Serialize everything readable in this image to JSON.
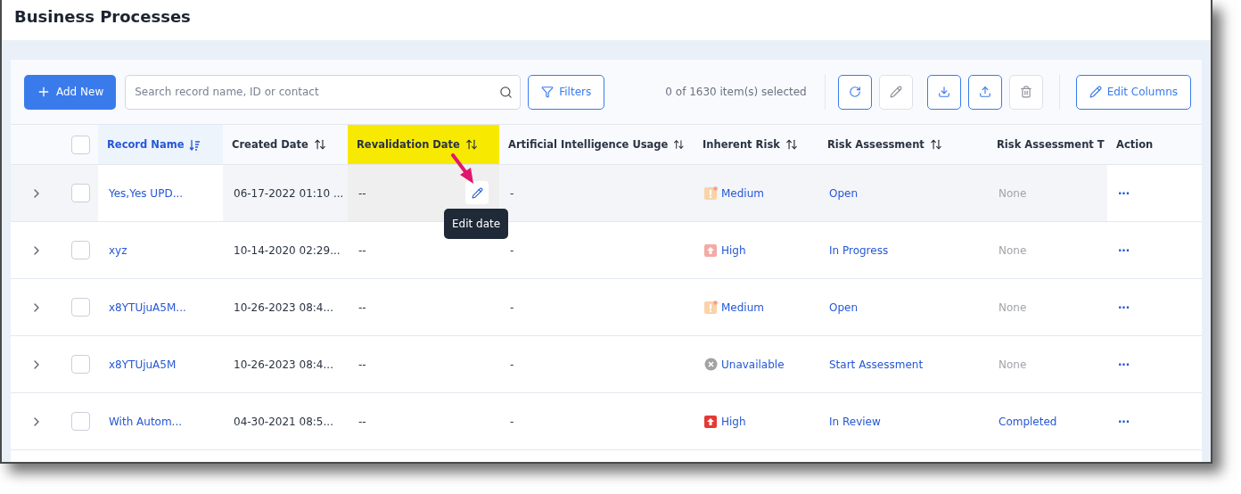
{
  "window": {
    "title": "Business Processes"
  },
  "toolbar": {
    "add_button": "Add New",
    "search": {
      "placeholder": "Search record name, ID or contact"
    },
    "filters_button": "Filters",
    "selection_count": "0 of 1630 item(s) selected",
    "icon_buttons": [
      {
        "kind": "refresh",
        "disabled": false
      },
      {
        "kind": "edit",
        "disabled": true
      },
      {
        "kind": "download",
        "disabled": false
      },
      {
        "kind": "upload",
        "disabled": false
      },
      {
        "kind": "delete",
        "disabled": true
      }
    ],
    "edit_columns_button": "Edit Columns"
  },
  "table": {
    "select_all": {
      "checked": false
    },
    "columns": [
      {
        "label": "Record Name",
        "kind": "sorted",
        "active": true,
        "highlighted": false
      },
      {
        "label": "Created Date",
        "kind": "sortable",
        "active": false,
        "highlighted": false
      },
      {
        "label": "Revalidation Date",
        "kind": "sortable",
        "active": false,
        "highlighted": true
      },
      {
        "label": "Artificial Intelligence Usage",
        "kind": "sortable",
        "active": false,
        "highlighted": false
      },
      {
        "label": "Inherent Risk",
        "kind": "sortable",
        "active": false,
        "highlighted": false
      },
      {
        "label": "Risk Assessment",
        "kind": "sortable",
        "active": false,
        "highlighted": false
      },
      {
        "label": "Risk Assessment T",
        "kind": "plain",
        "active": false,
        "highlighted": false
      },
      {
        "label": "Action",
        "kind": "plain",
        "active": false,
        "highlighted": false
      }
    ],
    "rows": [
      {
        "hovered": true,
        "checked": false,
        "name": "Yes,Yes UPD...",
        "created": "06-17-2022 01:10 ...",
        "revalidation": "--",
        "ai_usage": "-",
        "risk": {
          "label": "Medium",
          "kind": "alert",
          "color": "#fbd3a8"
        },
        "assessment": "Open",
        "assessment_to": {
          "label": "None",
          "muted": true
        },
        "action": "···",
        "edit_tooltip": "Edit date"
      },
      {
        "hovered": false,
        "checked": false,
        "name": "xyz",
        "created": "10-14-2020 02:29...",
        "revalidation": "--",
        "ai_usage": "-",
        "risk": {
          "label": "High",
          "kind": "up",
          "color": "#f4aaa5"
        },
        "assessment": "In Progress",
        "assessment_to": {
          "label": "None",
          "muted": true
        },
        "action": "···"
      },
      {
        "hovered": false,
        "checked": false,
        "name": "x8YTUjuA5M...",
        "created": "10-26-2023 08:4...",
        "revalidation": "--",
        "ai_usage": "-",
        "risk": {
          "label": "Medium",
          "kind": "alert",
          "color": "#fbd3a8"
        },
        "assessment": "Open",
        "assessment_to": {
          "label": "None",
          "muted": true
        },
        "action": "···"
      },
      {
        "hovered": false,
        "checked": false,
        "name": "x8YTUjuA5M",
        "created": "10-26-2023 08:4...",
        "revalidation": "--",
        "ai_usage": "-",
        "risk": {
          "label": "Unavailable",
          "kind": "cross",
          "color": "#a3a3a3"
        },
        "assessment": "Start Assessment",
        "assessment_to": {
          "label": "None",
          "muted": true
        },
        "action": "···"
      },
      {
        "hovered": false,
        "checked": false,
        "name": "With Autom...",
        "created": "04-30-2021 08:5...",
        "revalidation": "--",
        "ai_usage": "-",
        "risk": {
          "label": "High",
          "kind": "up",
          "color": "#e53935"
        },
        "assessment": "In Review",
        "assessment_to": {
          "label": "Completed",
          "muted": false
        },
        "action": "···"
      }
    ]
  }
}
